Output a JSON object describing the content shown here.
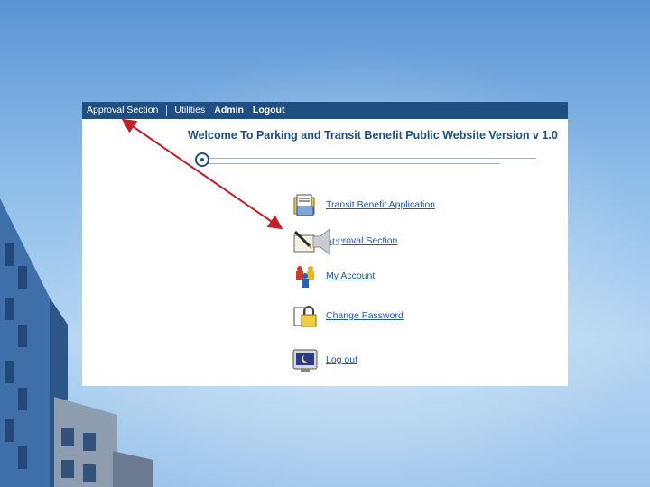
{
  "menubar": {
    "items": [
      {
        "label": "Approval Section"
      },
      {
        "label": "Utilities"
      },
      {
        "label": "Admin"
      },
      {
        "label": "Logout"
      }
    ]
  },
  "header": {
    "welcome": "Welcome To Parking and Transit Benefit Public Website Version v 1.0"
  },
  "main_menu": {
    "items": [
      {
        "label": "Transit Benefit Application",
        "icon": "folder-document-icon"
      },
      {
        "label": "Approval Section",
        "icon": "pen-signature-icon"
      },
      {
        "label": "My Account",
        "icon": "people-icon"
      },
      {
        "label": "Change Password",
        "icon": "lock-icon"
      },
      {
        "label": "Log out",
        "icon": "monitor-moon-icon"
      }
    ]
  },
  "colors": {
    "menubar_bg": "#1f4f82",
    "link": "#1f5aa8",
    "annotation_arrow": "#c0202a"
  }
}
